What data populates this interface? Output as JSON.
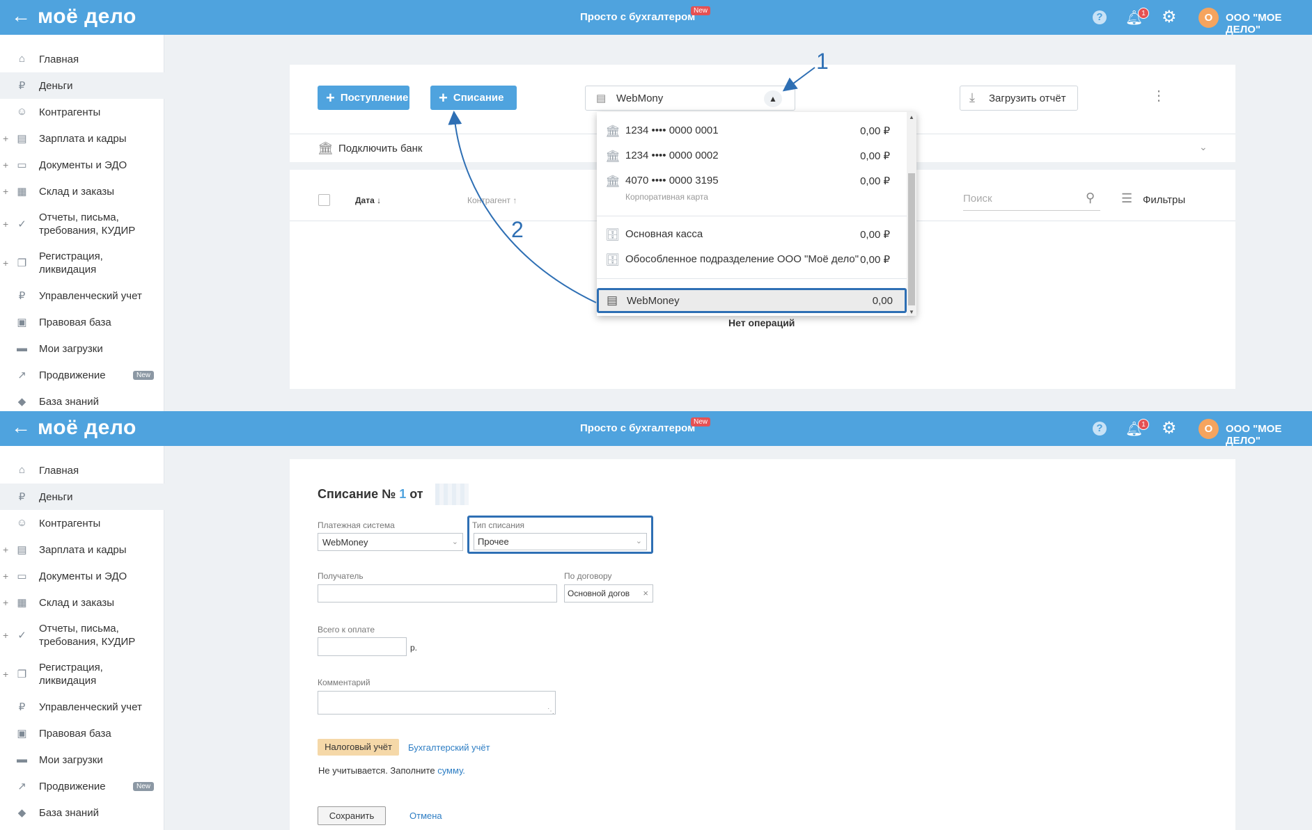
{
  "header": {
    "back_icon": "arrow-left-icon",
    "logo": "моё дело",
    "tagline": "Просто с бухгалтером",
    "new_badge": "New",
    "help": "?",
    "notification_count": "1",
    "avatar_letter": "О",
    "org_name": "ООО \"МОЕ ДЕЛО\""
  },
  "sidebar": {
    "items": [
      {
        "label": "Главная",
        "icon": "home-icon",
        "plus": ""
      },
      {
        "label": "Деньги",
        "icon": "money-icon",
        "plus": ""
      },
      {
        "label": "Контрагенты",
        "icon": "contractors-icon",
        "plus": ""
      },
      {
        "label": "Зарплата и кадры",
        "icon": "salary-icon",
        "plus": "+"
      },
      {
        "label": "Документы и ЭДО",
        "icon": "documents-icon",
        "plus": "+"
      },
      {
        "label": "Склад и заказы",
        "icon": "warehouse-icon",
        "plus": "+"
      },
      {
        "label": "Отчеты, письма,\nтребования, КУДИР",
        "icon": "reports-icon",
        "plus": "+"
      },
      {
        "label": "Регистрация,\nликвидация",
        "icon": "registration-icon",
        "plus": "+"
      },
      {
        "label": "Управленческий учет",
        "icon": "management-icon",
        "plus": ""
      },
      {
        "label": "Правовая база",
        "icon": "law-icon",
        "plus": ""
      },
      {
        "label": "Мои загрузки",
        "icon": "folder-icon",
        "plus": ""
      },
      {
        "label": "Продвижение",
        "icon": "promo-icon",
        "plus": "",
        "badge": "New"
      },
      {
        "label": "База знаний",
        "icon": "knowledge-icon",
        "plus": ""
      }
    ]
  },
  "money": {
    "income_button": "Поступление",
    "expense_button": "Списание",
    "account_select": "WebMony",
    "upload_report": "Загрузить отчёт",
    "connect_bank": "Подключить банк",
    "col_date": "Дата",
    "col_contractor": "Контрагент",
    "search_placeholder": "Поиск",
    "filters": "Фильтры",
    "no_operations": "Нет операций",
    "dropdown": [
      {
        "label": "1234 •••• 0000 0001",
        "value": "0,00 ₽",
        "sub": ""
      },
      {
        "label": "1234 •••• 0000 0002",
        "value": "0,00 ₽",
        "sub": ""
      },
      {
        "label": "4070 •••• 0000 3195",
        "value": "0,00 ₽",
        "sub": "Корпоративная карта"
      },
      {
        "label": "Основная касса",
        "value": "0,00 ₽",
        "sub": ""
      },
      {
        "label": "Обособленное подразделение ООО \"Моё дело\"",
        "value": "0,00 ₽",
        "sub": ""
      },
      {
        "label": "WebMoney",
        "value": "0,00",
        "sub": ""
      }
    ],
    "annotation_1": "1",
    "annotation_2": "2"
  },
  "form": {
    "title_prefix": "Списание №",
    "number": "1",
    "title_from": "от",
    "payment_system_label": "Платежная система",
    "payment_system_value": "WebMoney",
    "write_off_type_label": "Тип списания",
    "write_off_type_value": "Прочее",
    "recipient_label": "Получатель",
    "contract_label": "По договору",
    "contract_value": "Основной догов",
    "total_label": "Всего к оплате",
    "currency": "р.",
    "comment_label": "Комментарий",
    "tax_tab": "Налоговый учёт",
    "accounting_tab": "Бухгалтерский учёт",
    "not_counted": "Не учитывается. Заполните",
    "sum_link": "сумму.",
    "save": "Сохранить",
    "cancel": "Отмена"
  },
  "colors": {
    "header": "#4fa3de",
    "accent": "#4fa3de",
    "highlight_border": "#2e6fb4",
    "new_badge": "#e55153",
    "avatar": "#f5a45e"
  }
}
